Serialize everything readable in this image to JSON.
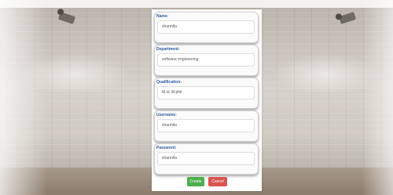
{
  "form": {
    "fields": [
      {
        "label": "Name:",
        "value": "sharmila"
      },
      {
        "label": "Department:",
        "value": "software engineering"
      },
      {
        "label": "Qualification:",
        "value": "M.sc M.phil"
      },
      {
        "label": "Username:",
        "value": "sharmila"
      },
      {
        "label": "Password:",
        "value": "sharmila"
      }
    ],
    "create_label": "Create",
    "cancel_label": "Cancel"
  },
  "colors": {
    "label_blue": "#2a5d9f",
    "create_green": "#4cae4c",
    "cancel_red": "#d9534f"
  }
}
